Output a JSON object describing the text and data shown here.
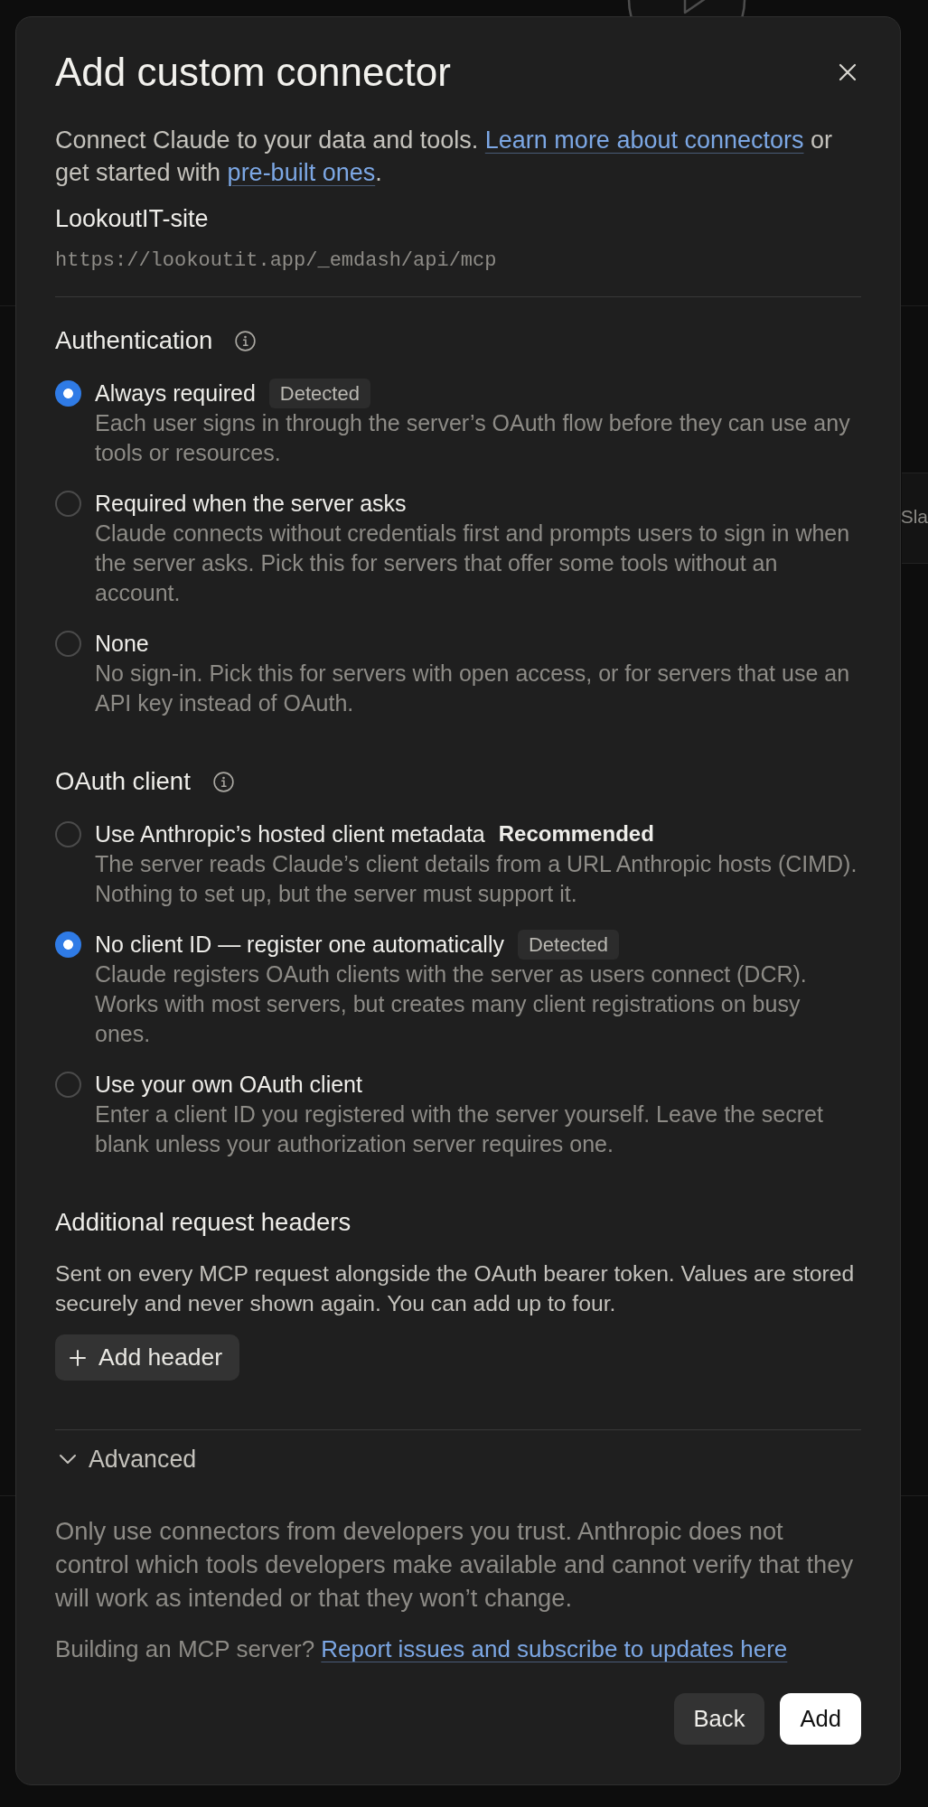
{
  "backdrop": {
    "edge_label": "Sla"
  },
  "dialog": {
    "title": "Add custom connector",
    "intro": [
      {
        "kind": "text",
        "text": "Connect Claude to your data and tools. "
      },
      {
        "kind": "link",
        "text": "Learn more about connectors"
      },
      {
        "kind": "text",
        "text": " or get started with "
      },
      {
        "kind": "link",
        "text": "pre-built ones"
      },
      {
        "kind": "text",
        "text": "."
      }
    ],
    "server": {
      "name": "LookoutIT-site",
      "url": "https://lookoutit.app/_emdash/api/mcp"
    },
    "sections": [
      {
        "kind": "radio_group",
        "heading": "Authentication",
        "info_icon": true,
        "options": [
          {
            "label": "Always required",
            "badge": {
              "kind": "pill",
              "text": "Detected"
            },
            "description": "Each user signs in through the server’s OAuth flow before they can use any tools or resources.",
            "selected": true
          },
          {
            "label": "Required when the server asks",
            "description": "Claude connects without credentials first and prompts users to sign in when the server asks. Pick this for servers that offer some tools without an account.",
            "selected": false
          },
          {
            "label": "None",
            "description": "No sign-in. Pick this for servers with open access, or for servers that use an API key instead of OAuth.",
            "selected": false
          }
        ]
      },
      {
        "kind": "radio_group",
        "heading": "OAuth client",
        "info_icon": true,
        "options": [
          {
            "label": "Use Anthropic’s hosted client metadata",
            "badge": {
              "kind": "emphasis",
              "text": "Recommended"
            },
            "description": "The server reads Claude’s client details from a URL Anthropic hosts (CIMD). Nothing to set up, but the server must support it.",
            "selected": false
          },
          {
            "label": "No client ID — register one automatically",
            "badge": {
              "kind": "pill",
              "text": "Detected"
            },
            "description": "Claude registers OAuth clients with the server as users connect (DCR). Works with most servers, but creates many client registrations on busy ones.",
            "selected": true
          },
          {
            "label": "Use your own OAuth client",
            "description": "Enter a client ID you registered with the server yourself. Leave the secret blank unless your authorization server requires one.",
            "selected": false
          }
        ]
      },
      {
        "kind": "headers",
        "heading": "Additional request headers",
        "description": "Sent on every MCP request alongside the OAuth bearer token. Values are stored securely and never shown again. You can add up to four.",
        "button": "Add header"
      }
    ],
    "advanced": {
      "label": "Advanced"
    },
    "notice": "Only use connectors from developers you trust. Anthropic does not control which tools developers make available and cannot verify that they will work as intended or that they won’t change.",
    "footer_note": [
      {
        "kind": "text",
        "text": "Building an MCP server? "
      },
      {
        "kind": "link",
        "text": "Report issues and subscribe to updates here"
      }
    ],
    "buttons": [
      {
        "kind": "secondary",
        "label": "Back"
      },
      {
        "kind": "primary",
        "label": "Add"
      }
    ]
  }
}
